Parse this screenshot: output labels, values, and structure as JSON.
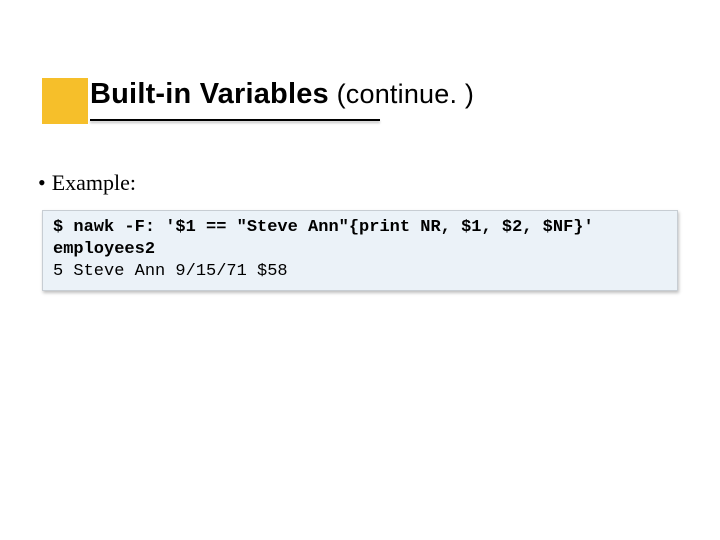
{
  "title": {
    "strong": "Built-in Variables",
    "light": " (continue. )"
  },
  "bullet": {
    "dot": "•",
    "text": "Example:"
  },
  "code": {
    "line1": "$ nawk -F: '$1 == \"Steve Ann\"{print NR, $1, $2, $NF}' employees2",
    "line2": "5 Steve Ann 9/15/71 $58"
  }
}
